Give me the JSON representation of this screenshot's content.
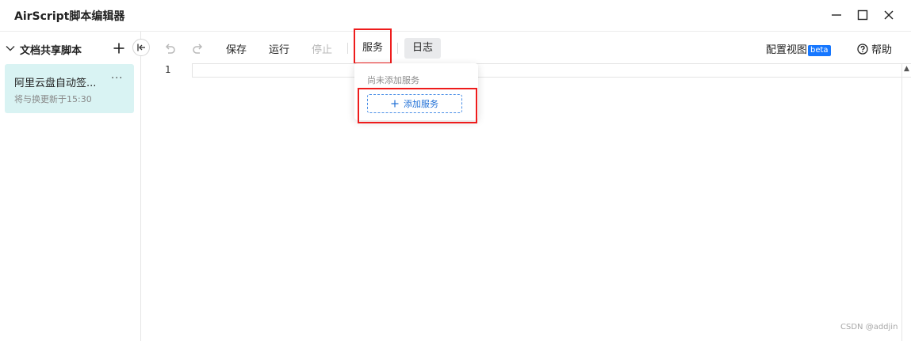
{
  "app": {
    "title": "AirScript脚本编辑器"
  },
  "sidebar": {
    "title": "文档共享脚本",
    "scripts": [
      {
        "name": "阿里云盘自动签...",
        "meta": "将与换更新于15:30"
      }
    ]
  },
  "toolbar": {
    "save_label": "保存",
    "run_label": "运行",
    "stop_label": "停止",
    "service_label": "服务",
    "log_label": "日志",
    "config_view_label": "配置视图",
    "beta_label": "beta",
    "help_label": "帮助"
  },
  "editor": {
    "line_numbers": [
      "1"
    ]
  },
  "service_dropdown": {
    "empty_text": "尚未添加服务",
    "add_label": "添加服务"
  },
  "watermark": "CSDN @addjin",
  "colors": {
    "accent": "#1677ff",
    "highlight": "#ee1c1c",
    "selected_item_bg": "#d9f3f3"
  }
}
